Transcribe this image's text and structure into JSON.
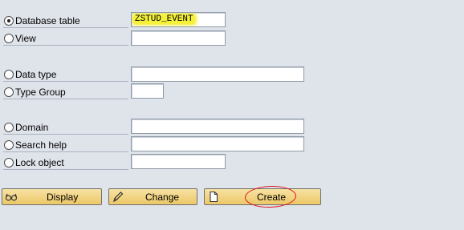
{
  "object_types": [
    {
      "label": "Database table",
      "selected": true,
      "value": "ZSTUD_EVENT"
    },
    {
      "label": "View",
      "selected": false,
      "value": ""
    },
    {
      "label": "Data type",
      "selected": false,
      "value": ""
    },
    {
      "label": "Type Group",
      "selected": false,
      "value": ""
    },
    {
      "label": "Domain",
      "selected": false,
      "value": ""
    },
    {
      "label": "Search help",
      "selected": false,
      "value": ""
    },
    {
      "label": "Lock object",
      "selected": false,
      "value": ""
    }
  ],
  "buttons": {
    "display": {
      "label": "Display",
      "icon": "glasses-icon"
    },
    "change": {
      "label": "Change",
      "icon": "pencil-icon"
    },
    "create": {
      "label": "Create",
      "icon": "blank-page-icon"
    }
  },
  "colors": {
    "background": "#dfe3ea",
    "button_face": "#ecc766",
    "highlight": "#f5f13a",
    "annotation_circle": "#e0141a"
  }
}
